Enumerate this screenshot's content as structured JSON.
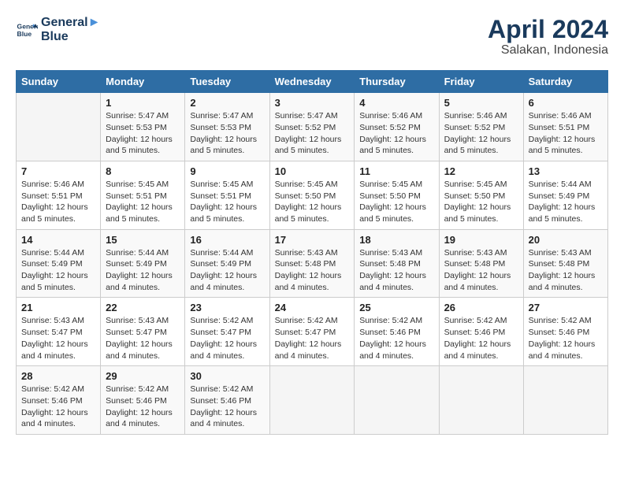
{
  "header": {
    "logo_line1": "General",
    "logo_line2": "Blue",
    "month": "April 2024",
    "location": "Salakan, Indonesia"
  },
  "weekdays": [
    "Sunday",
    "Monday",
    "Tuesday",
    "Wednesday",
    "Thursday",
    "Friday",
    "Saturday"
  ],
  "weeks": [
    [
      {
        "day": "",
        "info": ""
      },
      {
        "day": "1",
        "info": "Sunrise: 5:47 AM\nSunset: 5:53 PM\nDaylight: 12 hours\nand 5 minutes."
      },
      {
        "day": "2",
        "info": "Sunrise: 5:47 AM\nSunset: 5:53 PM\nDaylight: 12 hours\nand 5 minutes."
      },
      {
        "day": "3",
        "info": "Sunrise: 5:47 AM\nSunset: 5:52 PM\nDaylight: 12 hours\nand 5 minutes."
      },
      {
        "day": "4",
        "info": "Sunrise: 5:46 AM\nSunset: 5:52 PM\nDaylight: 12 hours\nand 5 minutes."
      },
      {
        "day": "5",
        "info": "Sunrise: 5:46 AM\nSunset: 5:52 PM\nDaylight: 12 hours\nand 5 minutes."
      },
      {
        "day": "6",
        "info": "Sunrise: 5:46 AM\nSunset: 5:51 PM\nDaylight: 12 hours\nand 5 minutes."
      }
    ],
    [
      {
        "day": "7",
        "info": "Sunrise: 5:46 AM\nSunset: 5:51 PM\nDaylight: 12 hours\nand 5 minutes."
      },
      {
        "day": "8",
        "info": "Sunrise: 5:45 AM\nSunset: 5:51 PM\nDaylight: 12 hours\nand 5 minutes."
      },
      {
        "day": "9",
        "info": "Sunrise: 5:45 AM\nSunset: 5:51 PM\nDaylight: 12 hours\nand 5 minutes."
      },
      {
        "day": "10",
        "info": "Sunrise: 5:45 AM\nSunset: 5:50 PM\nDaylight: 12 hours\nand 5 minutes."
      },
      {
        "day": "11",
        "info": "Sunrise: 5:45 AM\nSunset: 5:50 PM\nDaylight: 12 hours\nand 5 minutes."
      },
      {
        "day": "12",
        "info": "Sunrise: 5:45 AM\nSunset: 5:50 PM\nDaylight: 12 hours\nand 5 minutes."
      },
      {
        "day": "13",
        "info": "Sunrise: 5:44 AM\nSunset: 5:49 PM\nDaylight: 12 hours\nand 5 minutes."
      }
    ],
    [
      {
        "day": "14",
        "info": "Sunrise: 5:44 AM\nSunset: 5:49 PM\nDaylight: 12 hours\nand 5 minutes."
      },
      {
        "day": "15",
        "info": "Sunrise: 5:44 AM\nSunset: 5:49 PM\nDaylight: 12 hours\nand 4 minutes."
      },
      {
        "day": "16",
        "info": "Sunrise: 5:44 AM\nSunset: 5:49 PM\nDaylight: 12 hours\nand 4 minutes."
      },
      {
        "day": "17",
        "info": "Sunrise: 5:43 AM\nSunset: 5:48 PM\nDaylight: 12 hours\nand 4 minutes."
      },
      {
        "day": "18",
        "info": "Sunrise: 5:43 AM\nSunset: 5:48 PM\nDaylight: 12 hours\nand 4 minutes."
      },
      {
        "day": "19",
        "info": "Sunrise: 5:43 AM\nSunset: 5:48 PM\nDaylight: 12 hours\nand 4 minutes."
      },
      {
        "day": "20",
        "info": "Sunrise: 5:43 AM\nSunset: 5:48 PM\nDaylight: 12 hours\nand 4 minutes."
      }
    ],
    [
      {
        "day": "21",
        "info": "Sunrise: 5:43 AM\nSunset: 5:47 PM\nDaylight: 12 hours\nand 4 minutes."
      },
      {
        "day": "22",
        "info": "Sunrise: 5:43 AM\nSunset: 5:47 PM\nDaylight: 12 hours\nand 4 minutes."
      },
      {
        "day": "23",
        "info": "Sunrise: 5:42 AM\nSunset: 5:47 PM\nDaylight: 12 hours\nand 4 minutes."
      },
      {
        "day": "24",
        "info": "Sunrise: 5:42 AM\nSunset: 5:47 PM\nDaylight: 12 hours\nand 4 minutes."
      },
      {
        "day": "25",
        "info": "Sunrise: 5:42 AM\nSunset: 5:46 PM\nDaylight: 12 hours\nand 4 minutes."
      },
      {
        "day": "26",
        "info": "Sunrise: 5:42 AM\nSunset: 5:46 PM\nDaylight: 12 hours\nand 4 minutes."
      },
      {
        "day": "27",
        "info": "Sunrise: 5:42 AM\nSunset: 5:46 PM\nDaylight: 12 hours\nand 4 minutes."
      }
    ],
    [
      {
        "day": "28",
        "info": "Sunrise: 5:42 AM\nSunset: 5:46 PM\nDaylight: 12 hours\nand 4 minutes."
      },
      {
        "day": "29",
        "info": "Sunrise: 5:42 AM\nSunset: 5:46 PM\nDaylight: 12 hours\nand 4 minutes."
      },
      {
        "day": "30",
        "info": "Sunrise: 5:42 AM\nSunset: 5:46 PM\nDaylight: 12 hours\nand 4 minutes."
      },
      {
        "day": "",
        "info": ""
      },
      {
        "day": "",
        "info": ""
      },
      {
        "day": "",
        "info": ""
      },
      {
        "day": "",
        "info": ""
      }
    ]
  ]
}
